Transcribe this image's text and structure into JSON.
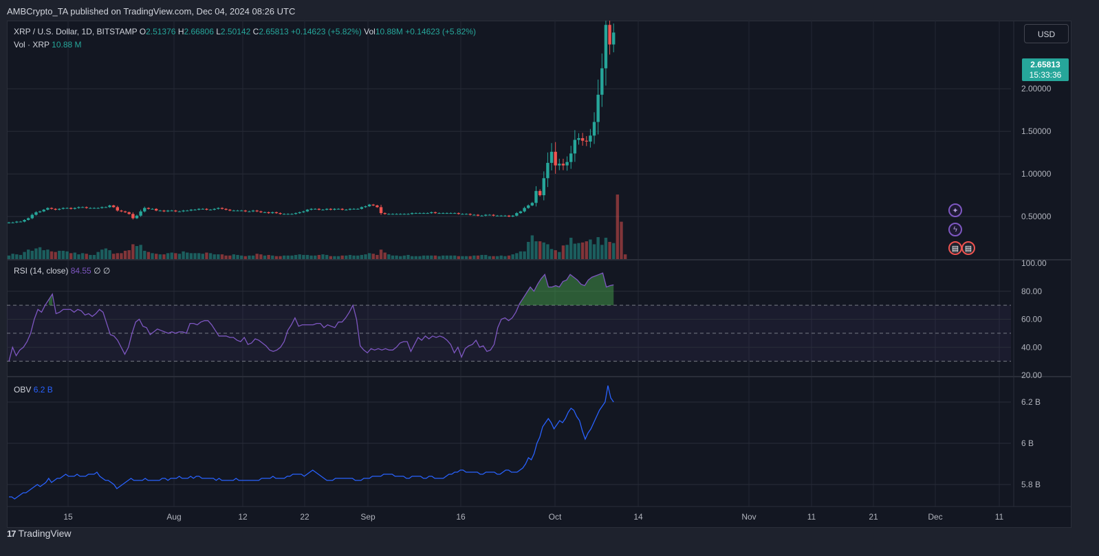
{
  "publisher_line": "AMBCrypto_TA published on TradingView.com, Dec 04, 2024 08:26 UTC",
  "symbol_line": {
    "title": "XRP / U.S. Dollar, 1D, BITSTAMP",
    "o_label": "O",
    "o_value": "2.51376",
    "h_label": "H",
    "h_value": "2.66806",
    "l_label": "L",
    "l_value": "2.50142",
    "c_label": "C",
    "c_value": "2.65813",
    "change": "+0.14623 (+5.82%)",
    "vol_label": "Vol",
    "vol_value": "10.88M",
    "vol_change": "+0.14623 (+5.82%)"
  },
  "volume_legend": {
    "label": "Vol · XRP",
    "value": "10.88 M"
  },
  "rsi_legend": {
    "label": "RSI (14, close)",
    "value": "84.55",
    "extra1": "∅",
    "extra2": "∅"
  },
  "obv_legend": {
    "label": "OBV",
    "value": "6.2 B"
  },
  "currency_button": "USD",
  "last_price": {
    "price": "2.65813",
    "countdown": "15:33:36"
  },
  "footer_brand": "TradingView",
  "colors": {
    "up": "#26a69a",
    "down": "#ef5350",
    "rsi": "#7e57c2",
    "obv": "#2962ff",
    "bg": "#131722"
  },
  "chart_data": [
    {
      "type": "candlestick",
      "title": "XRP / U.S. Dollar, 1D, BITSTAMP",
      "y_ticks": [
        "2.00000",
        "1.50000",
        "1.00000",
        "0.50000"
      ],
      "ylim": [
        0.0,
        2.8
      ],
      "x_ticks": [
        "15",
        "Aug",
        "12",
        "22",
        "Sep",
        "16",
        "Oct",
        "14",
        "Nov",
        "11",
        "21",
        "Dec",
        "11"
      ],
      "closes": [
        0.43,
        0.43,
        0.44,
        0.44,
        0.46,
        0.48,
        0.52,
        0.55,
        0.56,
        0.58,
        0.6,
        0.59,
        0.58,
        0.59,
        0.6,
        0.6,
        0.59,
        0.6,
        0.61,
        0.61,
        0.6,
        0.6,
        0.6,
        0.6,
        0.61,
        0.61,
        0.63,
        0.61,
        0.57,
        0.56,
        0.55,
        0.53,
        0.48,
        0.51,
        0.56,
        0.6,
        0.59,
        0.59,
        0.57,
        0.57,
        0.56,
        0.57,
        0.57,
        0.56,
        0.56,
        0.57,
        0.57,
        0.58,
        0.58,
        0.59,
        0.59,
        0.58,
        0.58,
        0.59,
        0.6,
        0.59,
        0.58,
        0.57,
        0.57,
        0.57,
        0.57,
        0.56,
        0.56,
        0.57,
        0.56,
        0.55,
        0.55,
        0.54,
        0.55,
        0.54,
        0.53,
        0.53,
        0.53,
        0.53,
        0.54,
        0.55,
        0.56,
        0.58,
        0.59,
        0.59,
        0.58,
        0.58,
        0.59,
        0.58,
        0.59,
        0.59,
        0.58,
        0.58,
        0.59,
        0.59,
        0.59,
        0.61,
        0.62,
        0.64,
        0.63,
        0.61,
        0.54,
        0.53,
        0.53,
        0.53,
        0.53,
        0.53,
        0.53,
        0.53,
        0.54,
        0.54,
        0.54,
        0.54,
        0.54,
        0.55,
        0.54,
        0.54,
        0.54,
        0.54,
        0.54,
        0.54,
        0.53,
        0.53,
        0.53,
        0.52,
        0.52,
        0.51,
        0.51,
        0.52,
        0.52,
        0.51,
        0.51,
        0.51,
        0.51,
        0.5,
        0.51,
        0.54,
        0.56,
        0.6,
        0.63,
        0.66,
        0.8,
        0.75,
        0.95,
        1.13,
        1.26,
        1.1,
        1.12,
        1.1,
        1.14,
        1.24,
        1.4,
        1.42,
        1.39,
        1.38,
        1.45,
        1.61,
        1.93,
        2.24,
        2.75,
        2.52,
        2.66
      ],
      "volume_ylim": [
        0,
        11.0
      ],
      "volumes": [
        0.6,
        0.9,
        0.8,
        0.7,
        1.2,
        1.6,
        1.4,
        1.8,
        2.0,
        1.5,
        1.6,
        1.3,
        1.2,
        1.4,
        1.4,
        1.3,
        1.0,
        1.1,
        0.8,
        1.0,
        0.9,
        0.7,
        0.7,
        1.2,
        1.6,
        1.8,
        1.5,
        0.9,
        1.0,
        1.0,
        1.4,
        1.5,
        2.5,
        2.2,
        2.4,
        1.4,
        1.2,
        1.0,
        0.9,
        0.8,
        0.8,
        1.0,
        1.1,
        1.0,
        0.9,
        1.3,
        1.1,
        1.0,
        1.0,
        1.0,
        0.9,
        1.1,
        1.0,
        0.8,
        0.8,
        0.8,
        0.6,
        0.6,
        0.8,
        0.7,
        0.6,
        0.5,
        0.6,
        0.6,
        0.9,
        0.8,
        0.6,
        0.7,
        0.6,
        0.5,
        0.5,
        0.6,
        0.6,
        0.6,
        0.7,
        0.8,
        0.7,
        0.7,
        0.6,
        0.6,
        0.7,
        0.8,
        0.7,
        0.5,
        0.5,
        0.5,
        0.6,
        0.6,
        0.7,
        0.6,
        0.6,
        0.7,
        0.8,
        1.0,
        0.9,
        0.7,
        1.6,
        1.1,
        0.8,
        0.6,
        0.6,
        0.5,
        0.6,
        0.7,
        0.5,
        0.5,
        0.5,
        0.6,
        0.6,
        0.6,
        0.6,
        0.5,
        0.6,
        0.6,
        0.6,
        0.6,
        0.5,
        0.5,
        0.5,
        0.5,
        0.6,
        0.6,
        0.7,
        0.7,
        0.5,
        0.5,
        0.5,
        0.6,
        0.5,
        0.6,
        0.8,
        1.0,
        1.3,
        1.3,
        2.9,
        4.0,
        3.0,
        3.0,
        2.8,
        2.5,
        1.7,
        1.5,
        1.2,
        2.3,
        2.4,
        3.6,
        2.6,
        2.7,
        2.8,
        3.0,
        3.3,
        2.5,
        3.7,
        2.4,
        3.6,
        2.9,
        2.7,
        10.88,
        6.3,
        0.8
      ]
    },
    {
      "type": "line",
      "title": "RSI (14, close)",
      "y_ticks": [
        "100.00",
        "80.00",
        "60.00",
        "40.00",
        "20.00"
      ],
      "ylim": [
        20,
        100
      ],
      "band": [
        30,
        70
      ],
      "mid": 50,
      "values": [
        30,
        40,
        34,
        38,
        40,
        44,
        50,
        60,
        67,
        65,
        70,
        74,
        78,
        64,
        65,
        67,
        67,
        67,
        65,
        67,
        66,
        63,
        64,
        62,
        64,
        67,
        65,
        57,
        49,
        48,
        45,
        40,
        35,
        40,
        50,
        58,
        60,
        55,
        54,
        49,
        51,
        53,
        52,
        51,
        50,
        51,
        50,
        51,
        51,
        50,
        57,
        57,
        56,
        58,
        59,
        59,
        56,
        52,
        48,
        48,
        48,
        47,
        47,
        45,
        44,
        47,
        42,
        43,
        46,
        45,
        43,
        41,
        38,
        37,
        38,
        40,
        44,
        52,
        56,
        61,
        55,
        56,
        56,
        56,
        56,
        57,
        57,
        54,
        56,
        55,
        54,
        58,
        58,
        61,
        65,
        70,
        60,
        41,
        38,
        36,
        39,
        38,
        39,
        38,
        39,
        38,
        38,
        40,
        43,
        44,
        44,
        37,
        42,
        47,
        45,
        48,
        46,
        48,
        47,
        48,
        47,
        45,
        42,
        36,
        40,
        33,
        39,
        41,
        42,
        45,
        40,
        41,
        37,
        38,
        42,
        54,
        60,
        61,
        59,
        61,
        65,
        71,
        75,
        79,
        83,
        80,
        85,
        89,
        92,
        83,
        83,
        84,
        83,
        87,
        88,
        92,
        90,
        88,
        85,
        84,
        88,
        90,
        91,
        92,
        93,
        83,
        84,
        84.55
      ]
    },
    {
      "type": "line",
      "title": "OBV",
      "y_ticks": [
        "6.2 B",
        "6 B",
        "5.8 B"
      ],
      "ylim": [
        5.7,
        6.3
      ],
      "values": [
        5.74,
        5.74,
        5.73,
        5.74,
        5.75,
        5.76,
        5.76,
        5.77,
        5.78,
        5.79,
        5.8,
        5.79,
        5.8,
        5.81,
        5.83,
        5.81,
        5.82,
        5.83,
        5.83,
        5.84,
        5.85,
        5.84,
        5.84,
        5.84,
        5.85,
        5.84,
        5.84,
        5.84,
        5.85,
        5.85,
        5.85,
        5.86,
        5.84,
        5.83,
        5.82,
        5.82,
        5.81,
        5.8,
        5.78,
        5.79,
        5.8,
        5.81,
        5.82,
        5.83,
        5.82,
        5.82,
        5.82,
        5.82,
        5.83,
        5.82,
        5.82,
        5.82,
        5.82,
        5.82,
        5.83,
        5.83,
        5.82,
        5.83,
        5.83,
        5.83,
        5.84,
        5.83,
        5.83,
        5.83,
        5.84,
        5.83,
        5.84,
        5.84,
        5.83,
        5.83,
        5.83,
        5.83,
        5.83,
        5.82,
        5.83,
        5.82,
        5.82,
        5.82,
        5.82,
        5.82,
        5.83,
        5.82,
        5.82,
        5.82,
        5.82,
        5.82,
        5.82,
        5.82,
        5.82,
        5.83,
        5.83,
        5.83,
        5.83,
        5.84,
        5.83,
        5.83,
        5.83,
        5.83,
        5.84,
        5.84,
        5.85,
        5.85,
        5.85,
        5.85,
        5.84,
        5.85,
        5.86,
        5.87,
        5.86,
        5.85,
        5.84,
        5.83,
        5.82,
        5.82,
        5.82,
        5.83,
        5.83,
        5.83,
        5.83,
        5.83,
        5.83,
        5.83,
        5.82,
        5.82,
        5.82,
        5.83,
        5.83,
        5.83,
        5.84,
        5.84,
        5.84,
        5.84,
        5.85,
        5.85,
        5.85,
        5.85,
        5.84,
        5.84,
        5.84,
        5.84,
        5.83,
        5.83,
        5.84,
        5.84,
        5.84,
        5.84,
        5.83,
        5.83,
        5.84,
        5.84,
        5.83,
        5.83,
        5.83,
        5.83,
        5.84,
        5.85,
        5.85,
        5.86,
        5.86,
        5.87,
        5.87,
        5.86,
        5.86,
        5.86,
        5.86,
        5.86,
        5.85,
        5.85,
        5.86,
        5.86,
        5.86,
        5.86,
        5.85,
        5.85,
        5.86,
        5.87,
        5.87,
        5.86,
        5.86,
        5.86,
        5.87,
        5.88,
        5.9,
        5.93,
        5.92,
        5.95,
        6.0,
        6.03,
        6.08,
        6.1,
        6.12,
        6.1,
        6.07,
        6.09,
        6.11,
        6.1,
        6.12,
        6.15,
        6.17,
        6.16,
        6.13,
        6.11,
        6.06,
        6.02,
        6.05,
        6.07,
        6.1,
        6.13,
        6.16,
        6.18,
        6.2,
        6.28,
        6.22,
        6.2
      ]
    }
  ]
}
